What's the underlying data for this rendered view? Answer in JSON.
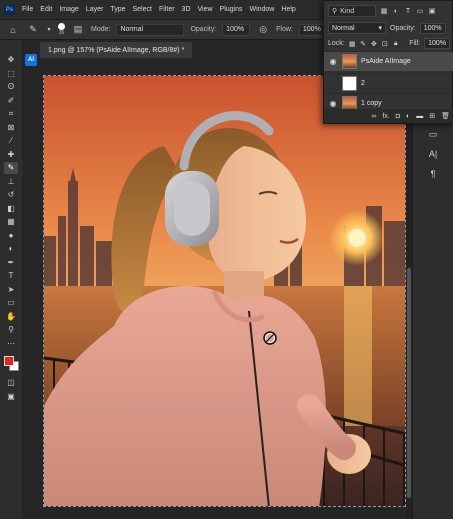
{
  "app": {
    "logo": "Ps"
  },
  "menu": [
    "File",
    "Edit",
    "Image",
    "Layer",
    "Type",
    "Select",
    "Filter",
    "3D",
    "View",
    "Plugins",
    "Window",
    "Help"
  ],
  "options": {
    "brush_size": "36",
    "mode_label": "Mode:",
    "mode_value": "Normal",
    "opacity_label": "Opacity:",
    "opacity_value": "100%",
    "flow_label": "Flow:",
    "flow_value": "100%"
  },
  "document": {
    "tab_title": "1.png @ 157% (PsAide AIImage, RGB/8#) *"
  },
  "second_bar": {
    "ai_badge": "AI"
  },
  "colors": {
    "foreground": "#e42416",
    "background": "#ffffff"
  },
  "layers_panel": {
    "filter_kind": "Kind",
    "blend_mode": "Normal",
    "opacity_label": "Opacity:",
    "opacity_value": "100%",
    "lock_label": "Lock:",
    "fill_label": "Fill:",
    "fill_value": "100%",
    "layers": [
      {
        "name": "PsAide AIImage",
        "visible": true,
        "selected": true,
        "thumb": "photo"
      },
      {
        "name": "2",
        "visible": false,
        "selected": false,
        "thumb": "check"
      },
      {
        "name": "1 copy",
        "visible": true,
        "selected": false,
        "thumb": "photo"
      }
    ],
    "bottom_icons": [
      "link-icon",
      "fx-icon",
      "mask-icon",
      "adjustment-icon",
      "folder-icon",
      "new-layer-icon",
      "trash-icon"
    ],
    "fx_label": "fx."
  },
  "tools": [
    "move-icon",
    "marquee-icon",
    "lasso-icon",
    "quick-select-icon",
    "crop-icon",
    "frame-icon",
    "eyedropper-icon",
    "healing-icon",
    "brush-icon",
    "stamp-icon",
    "history-brush-icon",
    "eraser-icon",
    "gradient-icon",
    "blur-icon",
    "dodge-icon",
    "pen-icon",
    "type-icon",
    "path-select-icon",
    "rectangle-icon",
    "hand-icon",
    "zoom-icon",
    "more-icon"
  ]
}
